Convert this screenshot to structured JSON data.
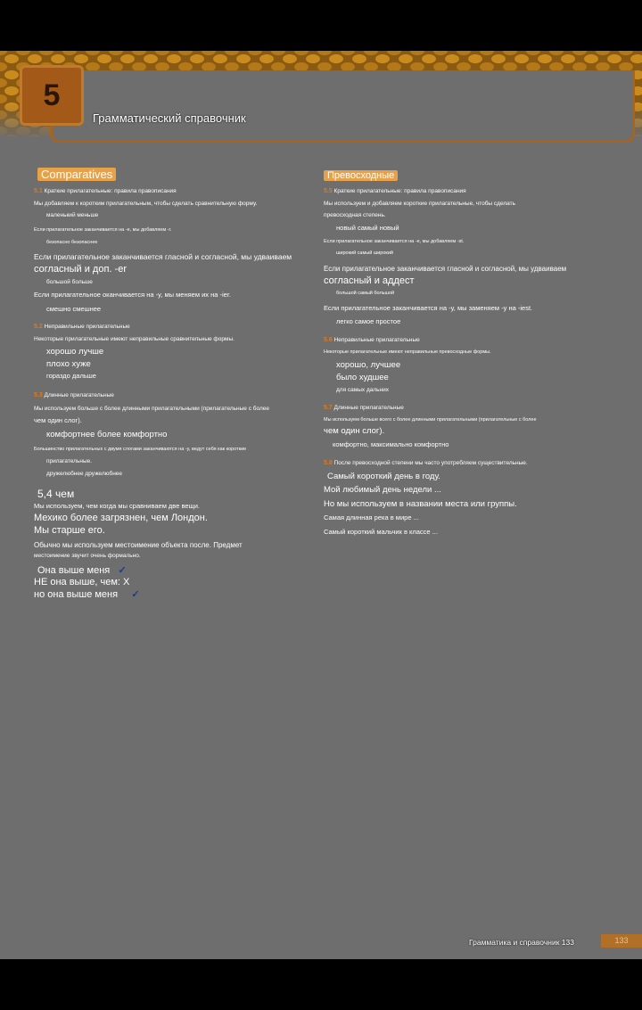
{
  "header": {
    "chapter": "5",
    "title": "Грамматический справочник"
  },
  "left": {
    "heading": "Comparatives",
    "s1": {
      "title": "5.1",
      "subtitle": "Краткие прилагательные: правила правописания",
      "lines": [
        "Мы добавляем к коротким прилагательным, чтобы сделать сравнительную форму.",
        "маленький меньше"
      ],
      "rule1": "Если прилагательное заканчивается на -e, мы добавляем -r.",
      "rule1_ex": "безопасно безопаснее",
      "rule2a": "Если прилагательное заканчивается гласной и согласной, мы удваиваем",
      "rule2b": "согласный и доп. -er",
      "rule2_ex": "большой больше",
      "rule3": "Если прилагательное оканчивается на -y, мы меняем их на -ier.",
      "rule3_ex": "смешно смешнее"
    },
    "s2": {
      "title": "5.2",
      "subtitle": "Неправильные прилагательные",
      "intro": "Некоторые прилагательные имеют неправильные сравнительные формы.",
      "ex1": "хорошо лучше",
      "ex2": "плохо хуже",
      "ex3": "гораздо дальше"
    },
    "s3": {
      "title": "5.3",
      "subtitle": "Длинные прилагательные",
      "intro": "Мы используем больше с более длинными прилагательными (прилагательные с более",
      "intro2": "чем один слог).",
      "ex1": "комфортнее более комфортно",
      "rule": "Большинство прилагательных с двумя слогами заканчиваются на -y, ведут себя как короткие",
      "rule2": "прилагательные.",
      "ex2": "дружелюбнее дружелюбнее"
    },
    "s4": {
      "title": "5,4 чем",
      "intro": "Мы используем, чем когда мы сравниваем две вещи.",
      "ex1": "Мехико более загрязнен, чем Лондон.",
      "ex2": "Мы старше его.",
      "rule": "Обычно мы используем местоимение объекта после. Предмет",
      "rule2": "местоимение звучит очень формально.",
      "ex3": "Она выше меня",
      "ex4": "НЕ она выше, чем: Х",
      "ex5": "но она выше меня"
    }
  },
  "right": {
    "heading": "Превосходные",
    "s5": {
      "title": "5.5",
      "subtitle": "Краткие прилагательные: правила правописания",
      "line1": "Мы используем и добавляем короткие прилагательные, чтобы сделать",
      "line2": "превосходная степень.",
      "ex": "новый самый новый",
      "rule1": "Если прилагательное заканчивается на -e, мы добавляем -st.",
      "rule1_ex": "широкий самый широкий",
      "rule2a": "Если прилагательное заканчивается гласной и согласной, мы удваиваем",
      "rule2b": "согласный и аддест",
      "rule2_ex": "большой самый большой",
      "rule3": "Если прилагательное заканчивается на -y, мы заменяем -y на -iest.",
      "rule3_ex": "легко самое простое"
    },
    "s6": {
      "title": "5.6",
      "subtitle": "Неправильные прилагательные",
      "intro": "Некоторые прилагательные имеют неправильные превосходные формы.",
      "ex1": "хорошо, лучшее",
      "ex2": "было худшее",
      "ex3": "для самых дальних"
    },
    "s7": {
      "title": "5.7",
      "subtitle": "Длинные прилагательные",
      "intro": "Мы используем больше всего с более длинными прилагательными (прилагательные с более",
      "intro2": "чем один слог).",
      "ex1": "комфортно, максимально комфортно"
    },
    "s8": {
      "title": "5.8",
      "subtitle": "После превосходной степени мы часто употребляем существительные.",
      "ex1": "Самый короткий день в году.",
      "ex2": "Мой любимый день недели ...",
      "rule": "Но мы используем в названии места или группы.",
      "ex3": "Самая длинная река в мире ...",
      "ex4": "Самый короткий мальчик в классе ..."
    }
  },
  "footer": {
    "text": "Грамматика и справочник 133",
    "page": "133"
  }
}
